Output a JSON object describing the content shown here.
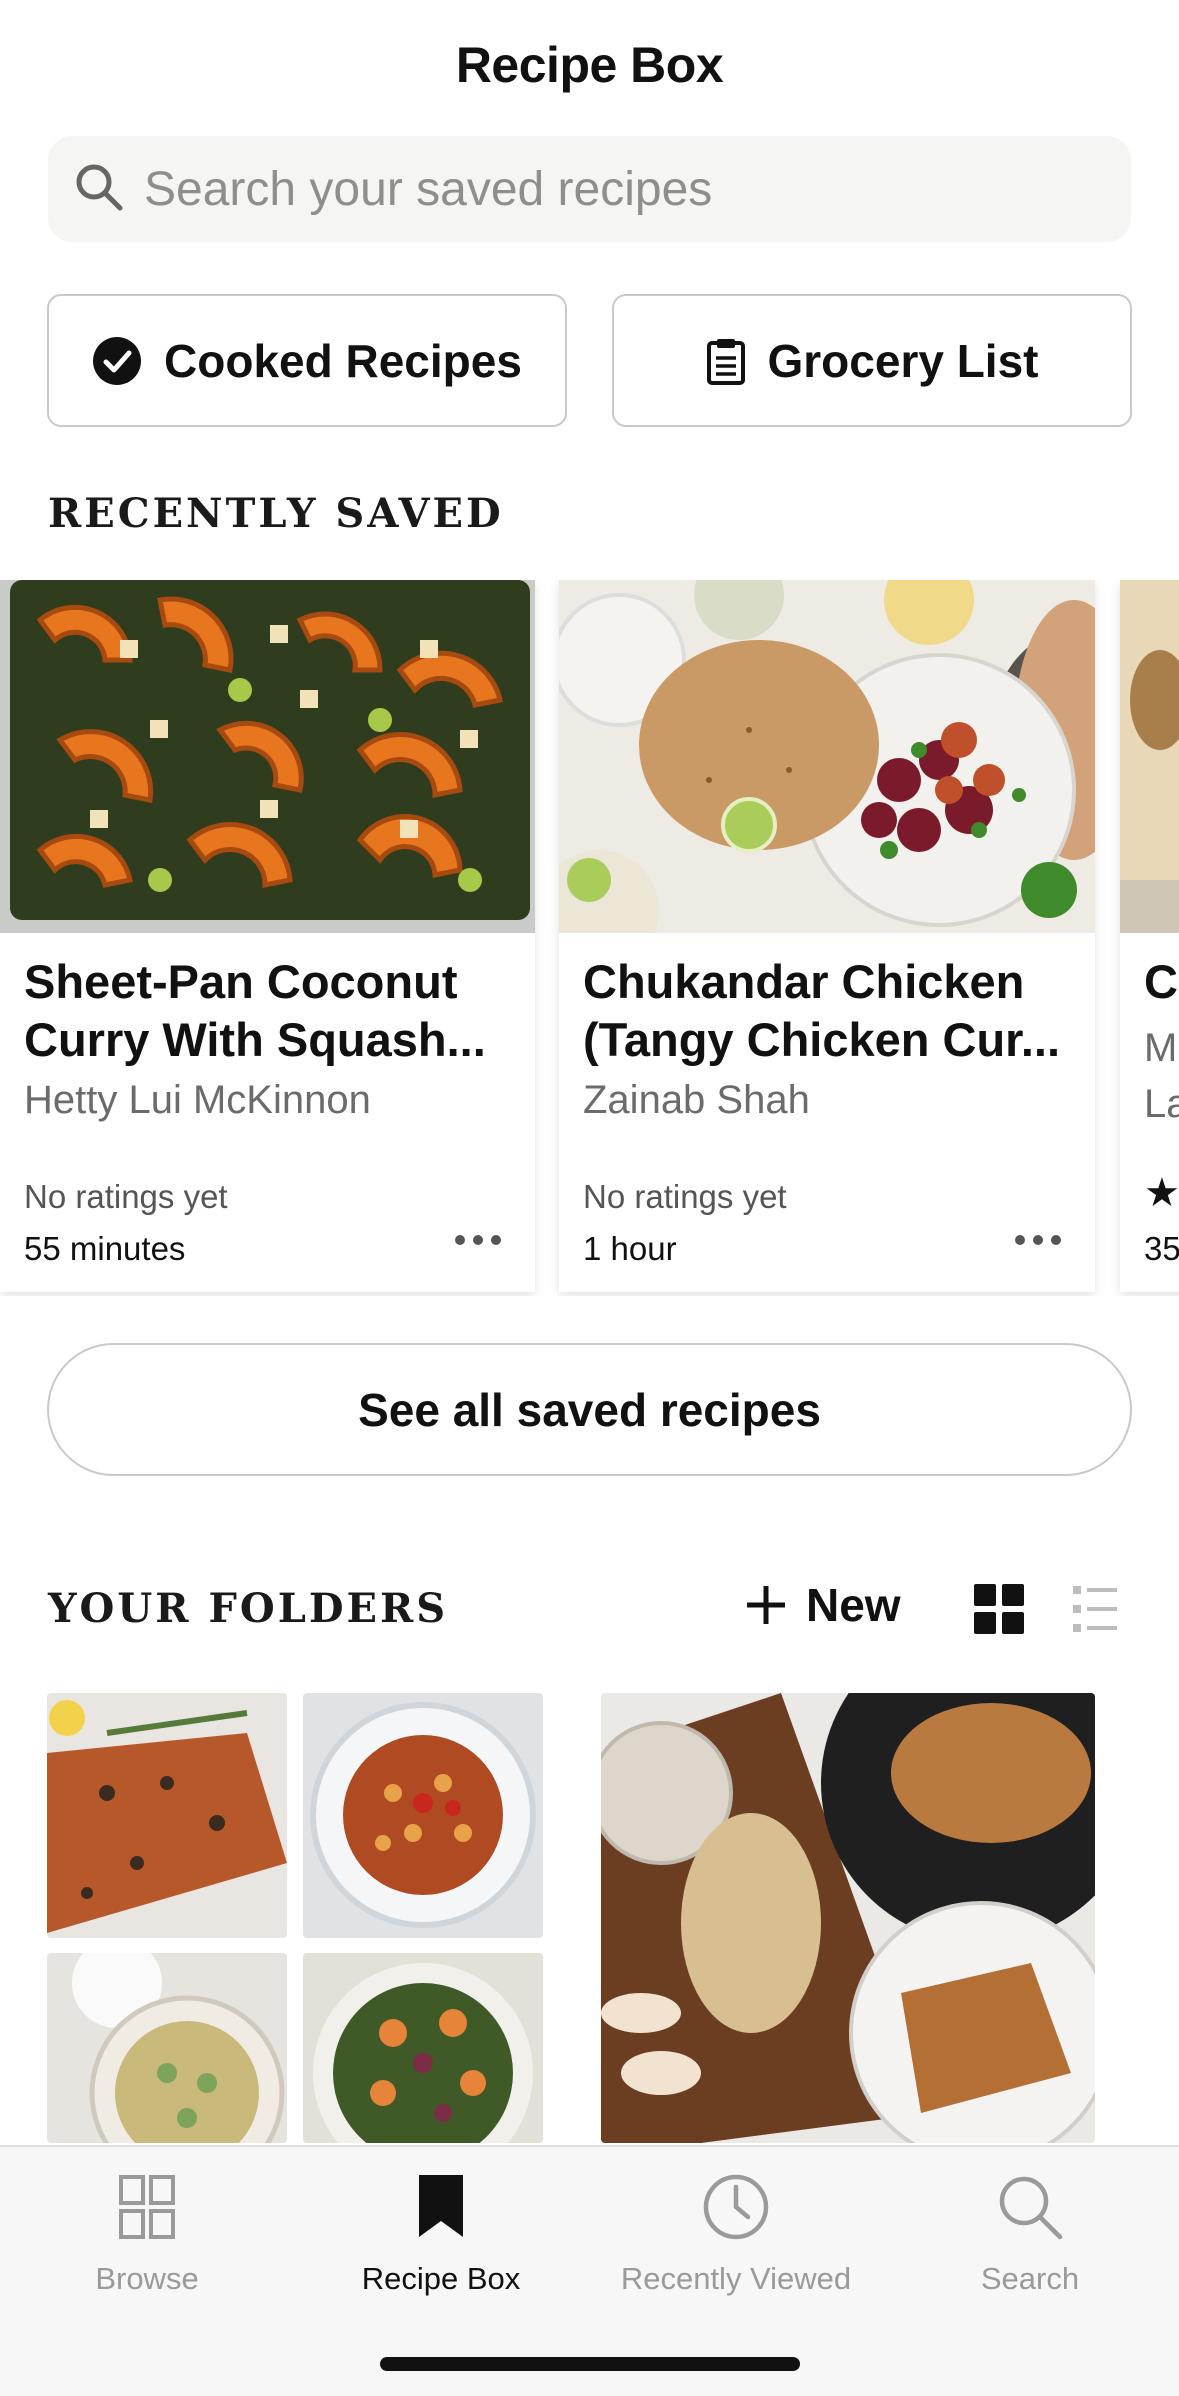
{
  "header": {
    "title": "Recipe Box"
  },
  "search": {
    "placeholder": "Search your saved recipes"
  },
  "actions": {
    "cooked_label": "Cooked Recipes",
    "grocery_label": "Grocery List"
  },
  "recently_saved": {
    "heading": "RECENTLY SAVED",
    "cards": [
      {
        "title": "Sheet-Pan Coconut Curry With Squash...",
        "author": "Hetty Lui McKinnon",
        "rating": "No ratings yet",
        "time": "55 minutes"
      },
      {
        "title": "Chukandar Chicken (Tangy Chicken Cur...",
        "author": "Zainab Shah",
        "rating": "No ratings yet",
        "time": "1 hour"
      },
      {
        "title": "Co",
        "author": "M",
        "author2": "La",
        "rating": "★",
        "time": "35"
      }
    ]
  },
  "see_all_label": "See all saved recipes",
  "folders": {
    "heading": "YOUR FOLDERS",
    "new_label": "New"
  },
  "tabbar": {
    "items": [
      {
        "label": "Browse",
        "icon": "grid-icon"
      },
      {
        "label": "Recipe Box",
        "icon": "bookmark-icon"
      },
      {
        "label": "Recently Viewed",
        "icon": "clock-icon"
      },
      {
        "label": "Search",
        "icon": "search-icon"
      }
    ],
    "active": "Recipe Box"
  },
  "colors": {
    "text": "#111111",
    "muted": "#9a9a9a",
    "border": "#c9c9c9",
    "search_bg": "#f5f5f3",
    "tabbar_bg": "#f7f7f7"
  }
}
